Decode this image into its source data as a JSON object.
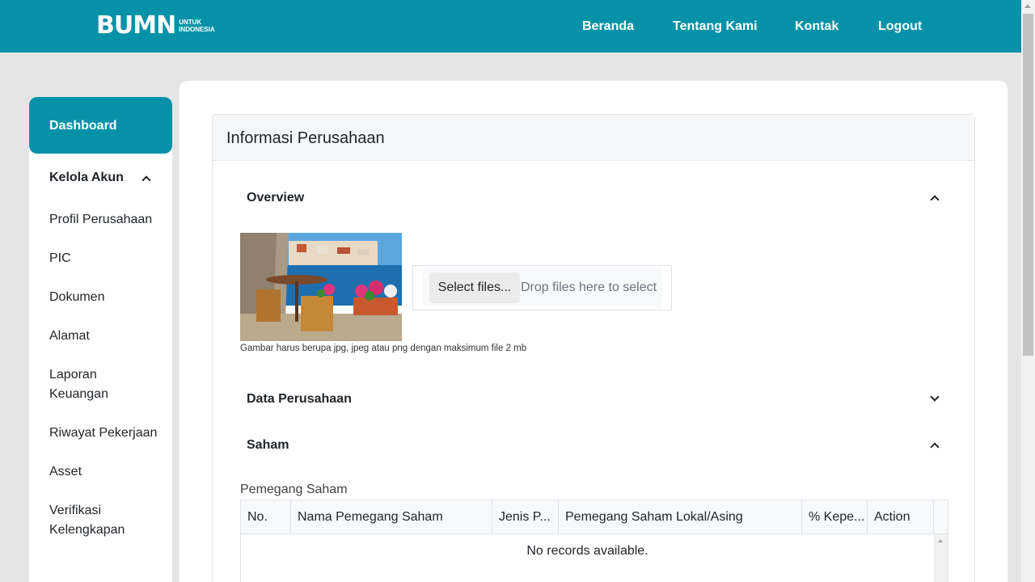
{
  "header": {
    "logo_mark": "BUMN",
    "logo_line1": "UNTUK",
    "logo_line2": "INDONESIA",
    "nav": [
      "Beranda",
      "Tentang Kami",
      "Kontak",
      "Logout"
    ]
  },
  "sidebar": {
    "active": "Dashboard",
    "group": "Kelola Akun",
    "items": [
      "Profil Perusahaan",
      "PIC",
      "Dokumen",
      "Alamat",
      "Laporan Keuangan",
      "Riwayat Pekerjaan",
      "Asset",
      "Verifikasi Kelengkapan"
    ]
  },
  "main": {
    "card_title": "Informasi Perusahaan",
    "overview_title": "Overview",
    "upload": {
      "select_label": "Select files...",
      "drop_hint": "Drop files here to select"
    },
    "image_hint": "Gambar harus berupa jpg, jpeg atau png dengan maksimum file 2 mb",
    "data_title": "Data Perusahaan",
    "saham_title": "Saham",
    "grid_label": "Pemegang Saham",
    "columns": [
      "No.",
      "Nama Pemegang Saham",
      "Jenis P...",
      "Pemegang Saham Lokal/Asing",
      "% Kepe...",
      "Action"
    ],
    "empty_text": "No records available."
  },
  "colors": {
    "brand": "#0592a8",
    "background": "#e5e5e5"
  }
}
